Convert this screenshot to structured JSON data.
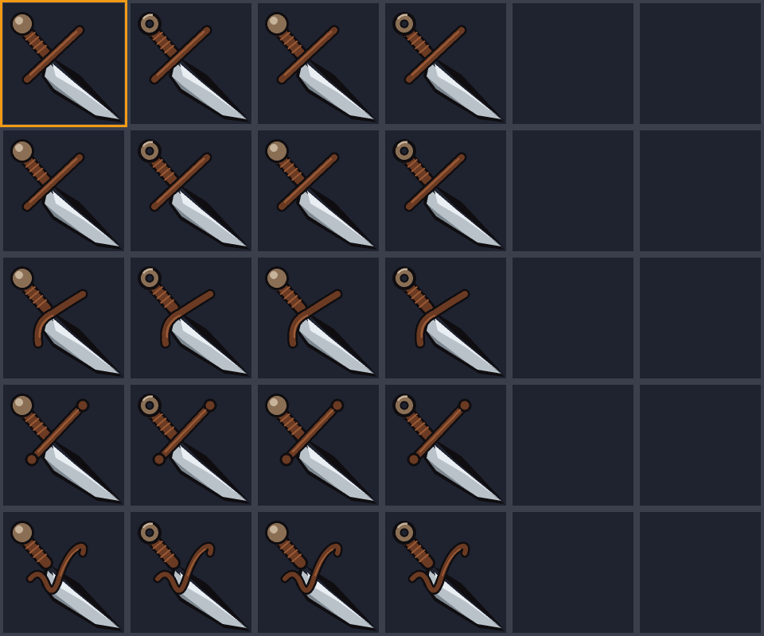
{
  "inventory": {
    "columns": 6,
    "rows": 5,
    "selected_slot": 0,
    "colors": {
      "background": "#3a3f4b",
      "slot": "#1f2330",
      "selection": "#f29a16",
      "blade_light": "#e9eef2",
      "blade_mid": "#b9c2c9",
      "blade_dark": "#7d8790",
      "leather": "#6b3a22",
      "leather_light": "#9a5a36",
      "bronze": "#8a6f55",
      "bronze_light": "#c7b29a",
      "outline": "#0f0d10"
    },
    "slots": [
      {
        "item": "dagger-icon",
        "guard": "straight",
        "pommel": "ball"
      },
      {
        "item": "dagger-icon",
        "guard": "straight",
        "pommel": "ring"
      },
      {
        "item": "dagger-icon",
        "guard": "straight",
        "pommel": "ball"
      },
      {
        "item": "dagger-icon",
        "guard": "straight",
        "pommel": "ring"
      },
      {
        "item": null
      },
      {
        "item": null
      },
      {
        "item": "dagger-icon",
        "guard": "straight",
        "pommel": "ball"
      },
      {
        "item": "dagger-icon",
        "guard": "straight",
        "pommel": "ring"
      },
      {
        "item": "dagger-icon",
        "guard": "straight",
        "pommel": "ball"
      },
      {
        "item": "dagger-icon",
        "guard": "straight",
        "pommel": "ring"
      },
      {
        "item": null
      },
      {
        "item": null
      },
      {
        "item": "dagger-icon",
        "guard": "curved",
        "pommel": "ball"
      },
      {
        "item": "dagger-icon",
        "guard": "curved",
        "pommel": "ring"
      },
      {
        "item": "dagger-icon",
        "guard": "curved",
        "pommel": "ball"
      },
      {
        "item": "dagger-icon",
        "guard": "curved",
        "pommel": "ring"
      },
      {
        "item": null
      },
      {
        "item": null
      },
      {
        "item": "dagger-icon",
        "guard": "bone",
        "pommel": "ball"
      },
      {
        "item": "dagger-icon",
        "guard": "bone",
        "pommel": "ring"
      },
      {
        "item": "dagger-icon",
        "guard": "bone",
        "pommel": "ball"
      },
      {
        "item": "dagger-icon",
        "guard": "bone",
        "pommel": "ring"
      },
      {
        "item": null
      },
      {
        "item": null
      },
      {
        "item": "dagger-icon",
        "guard": "swirl",
        "pommel": "ball"
      },
      {
        "item": "dagger-icon",
        "guard": "swirl",
        "pommel": "ring"
      },
      {
        "item": "dagger-icon",
        "guard": "swirl",
        "pommel": "ball"
      },
      {
        "item": "dagger-icon",
        "guard": "swirl",
        "pommel": "ring"
      },
      {
        "item": null
      },
      {
        "item": null
      }
    ]
  }
}
